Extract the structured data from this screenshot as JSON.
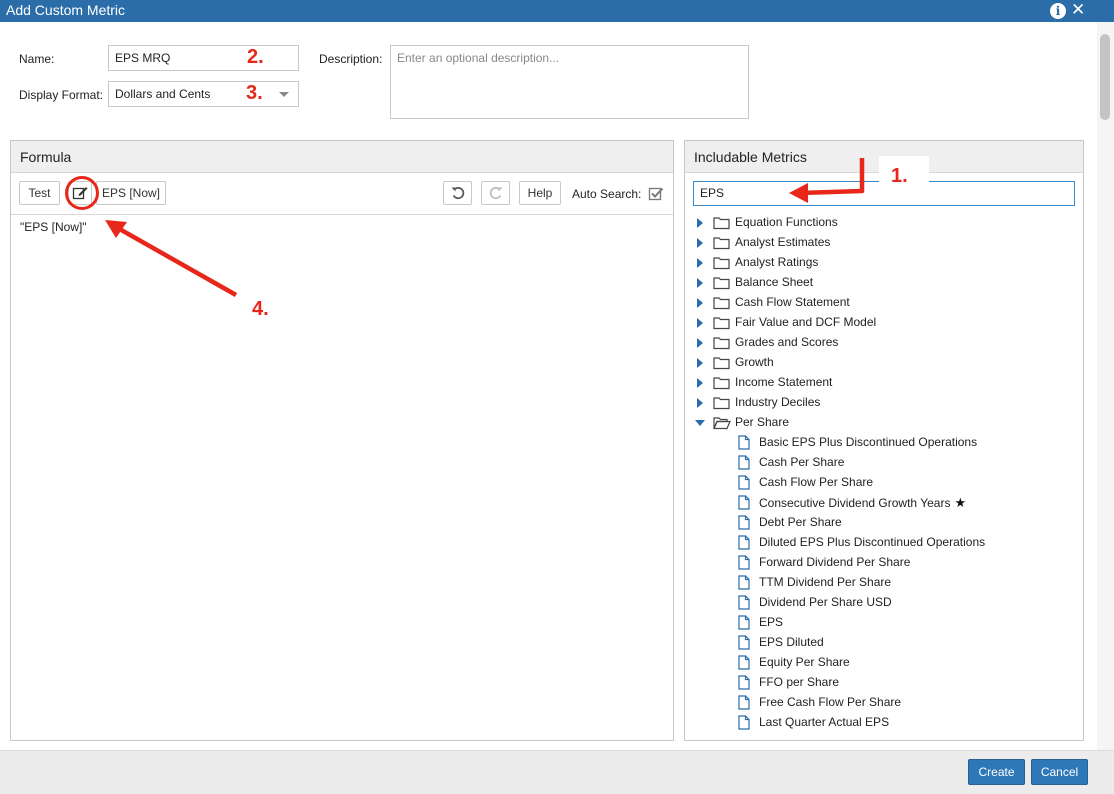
{
  "window": {
    "title": "Add Custom Metric"
  },
  "form": {
    "name_label": "Name:",
    "name_value": "EPS MRQ",
    "format_label": "Display Format:",
    "format_value": "Dollars and Cents",
    "description_label": "Description:",
    "description_placeholder": "Enter an optional description..."
  },
  "formula": {
    "title": "Formula",
    "test_label": "Test",
    "token_label": "EPS [Now]",
    "help_label": "Help",
    "auto_search_label": "Auto Search:",
    "auto_search_checked": true,
    "content": "\"EPS [Now]\""
  },
  "metrics": {
    "title": "Includable Metrics",
    "search_value": "EPS",
    "folders": [
      {
        "label": "Equation Functions",
        "expanded": false
      },
      {
        "label": "Analyst Estimates",
        "expanded": false
      },
      {
        "label": "Analyst Ratings",
        "expanded": false
      },
      {
        "label": "Balance Sheet",
        "expanded": false
      },
      {
        "label": "Cash Flow Statement",
        "expanded": false
      },
      {
        "label": "Fair Value and DCF Model",
        "expanded": false
      },
      {
        "label": "Grades and Scores",
        "expanded": false
      },
      {
        "label": "Growth",
        "expanded": false
      },
      {
        "label": "Income Statement",
        "expanded": false
      },
      {
        "label": "Industry Deciles",
        "expanded": false
      },
      {
        "label": "Per Share",
        "expanded": true
      }
    ],
    "items": [
      "Basic EPS Plus Discontinued Operations",
      "Cash Per Share",
      "Cash Flow Per Share",
      "Consecutive Dividend Growth Years",
      "Debt Per Share",
      "Diluted EPS Plus Discontinued Operations",
      "Forward Dividend Per Share",
      "TTM Dividend Per Share",
      "Dividend Per Share USD",
      "EPS",
      "EPS Diluted",
      "Equity Per Share",
      "FFO per Share",
      "Free Cash Flow Per Share",
      "Last Quarter Actual EPS"
    ],
    "starred_item": "Consecutive Dividend Growth Years"
  },
  "footer": {
    "create_label": "Create",
    "cancel_label": "Cancel"
  },
  "annotations": {
    "n1": "1.",
    "n2": "2.",
    "n3": "3.",
    "n4": "4."
  },
  "colors": {
    "titlebar": "#2a6da8",
    "primary_button": "#2f78b8",
    "annotation": "#e8271a"
  }
}
